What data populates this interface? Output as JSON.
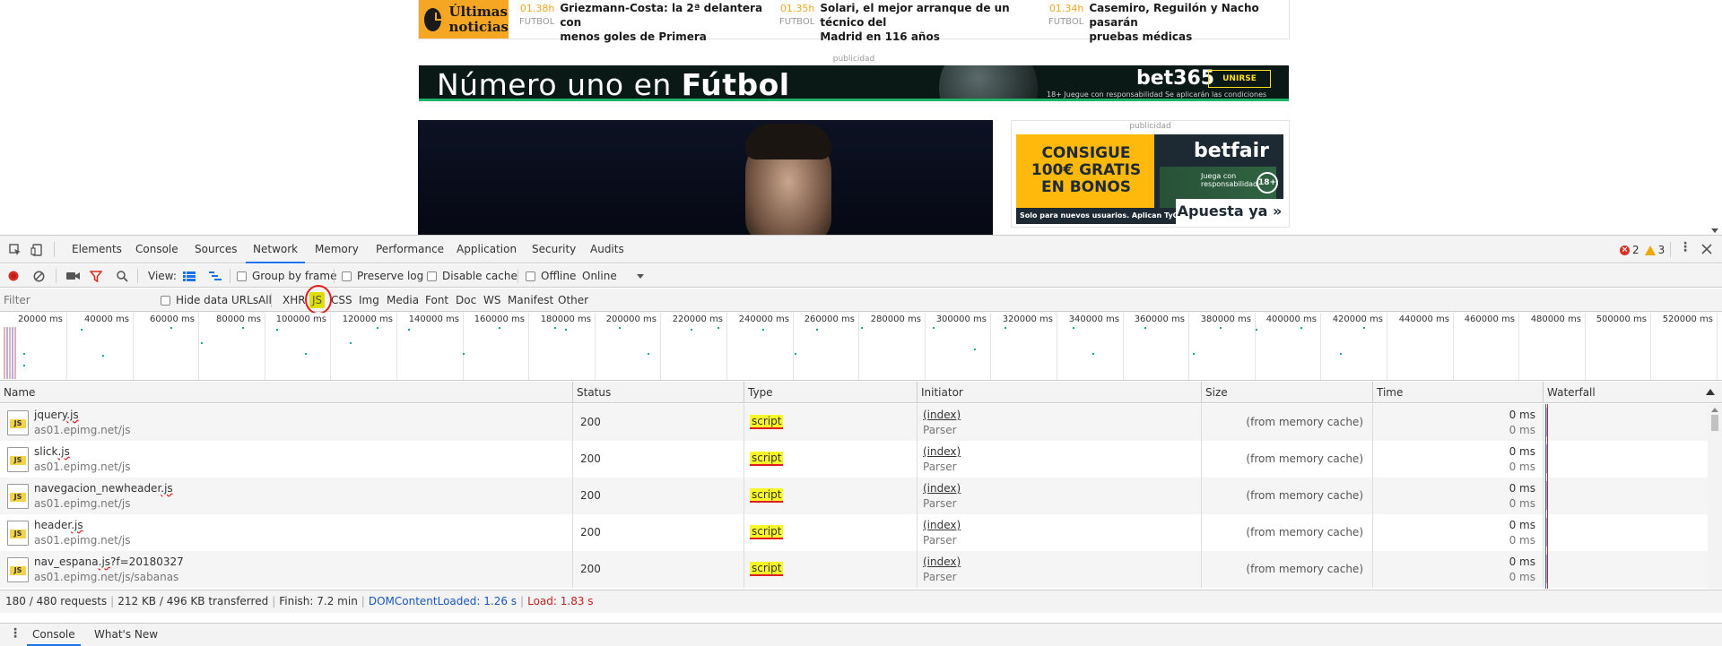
{
  "webpage": {
    "ultimas": {
      "title_line1": "Últimas",
      "title_line2": "noticias"
    },
    "news": [
      {
        "time": "01.38h",
        "category": "FUTBOL",
        "headline_line1": "Griezmann-Costa: la 2ª delantera con",
        "headline_line2": "menos goles de Primera"
      },
      {
        "time": "01.35h",
        "category": "FUTBOL",
        "headline_line1": "Solari, el mejor arranque de un técnico del",
        "headline_line2": "Madrid en 116 años"
      },
      {
        "time": "01.34h",
        "category": "FUTBOL",
        "headline_line1": "Casemiro, Reguilón y Nacho pasarán",
        "headline_line2": "pruebas médicas"
      }
    ],
    "ad_label": "publicidad",
    "banner": {
      "slogan_plain": "Número uno en ",
      "slogan_bold": "Fútbol",
      "brand": "bet365",
      "join": "UNIRSE",
      "disclaimer": "18+  Juegue con responsabilidad  Se aplicarán las condiciones"
    },
    "betfair": {
      "promo": "CONSIGUE 100€ GRATIS EN BONOS",
      "logo": "betfair",
      "responsible": "Juega con responsabilidad",
      "age": "18+",
      "cta": "Apuesta ya »",
      "small_print": "Solo para nuevos usuarios. Aplican TyC."
    }
  },
  "devtools": {
    "tabs": [
      "Elements",
      "Console",
      "Sources",
      "Network",
      "Memory",
      "Performance",
      "Application",
      "Security",
      "Audits"
    ],
    "active_tab": "Network",
    "errors": "2",
    "warnings": "3",
    "toolbar": {
      "view_label": "View:",
      "group_by_frame": "Group by frame",
      "preserve_log": "Preserve log",
      "disable_cache": "Disable cache",
      "offline": "Offline",
      "throttle": "Online"
    },
    "filter": {
      "placeholder": "Filter",
      "hide_data_urls": "Hide data URLs",
      "types": [
        "All",
        "XHR",
        "JS",
        "CSS",
        "Img",
        "Media",
        "Font",
        "Doc",
        "WS",
        "Manifest",
        "Other"
      ],
      "active_type": "JS"
    },
    "overview_ticks": [
      "20000 ms",
      "40000 ms",
      "60000 ms",
      "80000 ms",
      "100000 ms",
      "120000 ms",
      "140000 ms",
      "160000 ms",
      "180000 ms",
      "200000 ms",
      "220000 ms",
      "240000 ms",
      "260000 ms",
      "280000 ms",
      "300000 ms",
      "320000 ms",
      "340000 ms",
      "360000 ms",
      "380000 ms",
      "400000 ms",
      "420000 ms",
      "440000 ms",
      "460000 ms",
      "480000 ms",
      "500000 ms",
      "520000 ms"
    ],
    "columns": [
      "Name",
      "Status",
      "Type",
      "Initiator",
      "Size",
      "Time",
      "Waterfall"
    ],
    "requests": [
      {
        "name": "jquery",
        "ext": ".js",
        "query": "",
        "domain": "as01.epimg.net/js",
        "status": "200",
        "type": "script",
        "initiator": "(index)",
        "initiator_type": "Parser",
        "size": "(from memory cache)",
        "time": "0 ms",
        "latency": "0 ms"
      },
      {
        "name": "slick",
        "ext": ".js",
        "query": "",
        "domain": "as01.epimg.net/js",
        "status": "200",
        "type": "script",
        "initiator": "(index)",
        "initiator_type": "Parser",
        "size": "(from memory cache)",
        "time": "0 ms",
        "latency": "0 ms"
      },
      {
        "name": "navegacion_newheader",
        "ext": ".js",
        "query": "",
        "domain": "as01.epimg.net/js",
        "status": "200",
        "type": "script",
        "initiator": "(index)",
        "initiator_type": "Parser",
        "size": "(from memory cache)",
        "time": "0 ms",
        "latency": "0 ms"
      },
      {
        "name": "header",
        "ext": ".js",
        "query": "",
        "domain": "as01.epimg.net/js",
        "status": "200",
        "type": "script",
        "initiator": "(index)",
        "initiator_type": "Parser",
        "size": "(from memory cache)",
        "time": "0 ms",
        "latency": "0 ms"
      },
      {
        "name": "nav_espana",
        "ext": ".js",
        "query": "?f=20180327",
        "domain": "as01.epimg.net/js/sabanas",
        "status": "200",
        "type": "script",
        "initiator": "(index)",
        "initiator_type": "Parser",
        "size": "(from memory cache)",
        "time": "0 ms",
        "latency": "0 ms"
      }
    ],
    "summary": {
      "requests": "180 / 480 requests",
      "transferred": "212 KB / 496 KB transferred",
      "finish": "Finish: 7.2 min",
      "dom_content_loaded": "DOMContentLoaded: 1.26 s",
      "load": "Load: 1.83 s"
    },
    "drawer_tabs": [
      "Console",
      "What's New"
    ]
  }
}
